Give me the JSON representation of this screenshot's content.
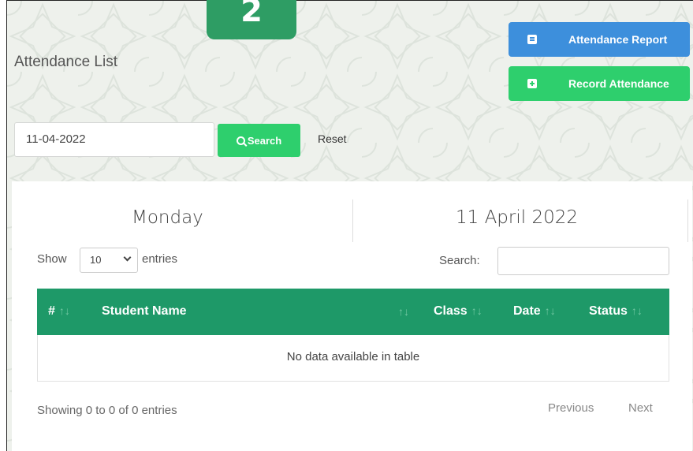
{
  "badge": "2",
  "page": {
    "title": "Attendance List"
  },
  "actions": {
    "report_label": "Attendance Report",
    "record_label": "Record Attendance"
  },
  "filter": {
    "date_value": "11-04-2022",
    "search_label": "Search",
    "reset_label": "Reset"
  },
  "summary": {
    "day": "Monday",
    "date": "11 April 2022"
  },
  "table_controls": {
    "show_label": "Show",
    "page_size": "10",
    "entries_label": "entries",
    "search_label": "Search:"
  },
  "table": {
    "columns": [
      "#",
      "Student Name",
      "Class",
      "Date",
      "Status"
    ],
    "empty_message": "No data available in table"
  },
  "footer": {
    "info": "Showing 0 to 0 of 0 entries",
    "previous": "Previous",
    "next": "Next"
  },
  "colors": {
    "header_green": "#1e9968",
    "action_green": "#2ecf6d",
    "action_blue": "#3d8fdc"
  },
  "icons": {
    "report": "list-icon",
    "record": "plus-square-icon",
    "search": "search-icon",
    "select": "chevron-down-icon",
    "sort": "sort-icon"
  }
}
